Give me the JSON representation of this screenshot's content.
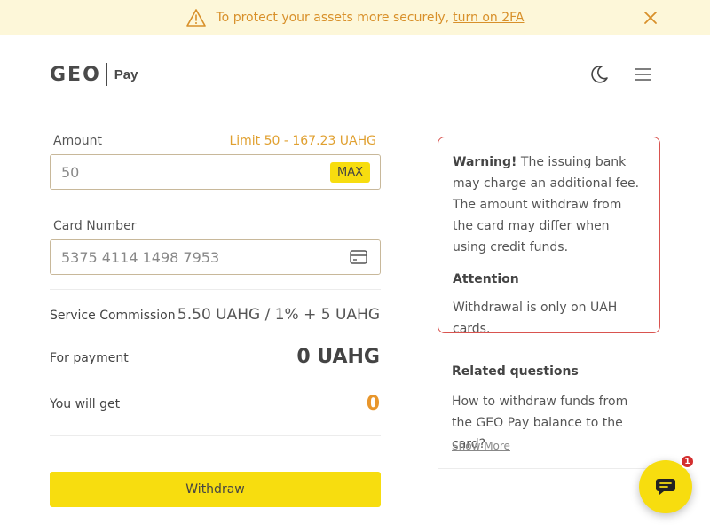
{
  "banner": {
    "text": "To protect your assets more securely,",
    "link": "turn on 2FA",
    "icon": "warning-icon",
    "close_icon": "close-icon"
  },
  "header": {
    "logo_mark": "GEO",
    "logo_product": "Pay",
    "theme_icon": "moon-icon",
    "menu_icon": "hamburger-menu-icon"
  },
  "form": {
    "amount_label": "Amount",
    "limit_text": "Limit 50 - 167.23 UAHG",
    "amount_value": "50",
    "max_label": "MAX",
    "card_label": "Card Number",
    "card_value": "5375 4114 1498 7953",
    "card_icon": "credit-card-icon"
  },
  "summary": {
    "commission_label": "Service Commission",
    "commission_value": "5.50 UAHG / 1% + 5 UAHG",
    "payment_label": "For payment",
    "payment_value": "0 UAHG",
    "get_label": "You will get",
    "get_value": "0"
  },
  "withdraw_label": "Withdraw",
  "warning": {
    "title": "Warning!",
    "text": "The issuing bank may charge an additional fee. The amount withdraw from the card may differ when using credit funds.",
    "attention_title": "Attention",
    "attention_text": "Withdrawal is only on UAH cards."
  },
  "related": {
    "title": "Related questions",
    "question": "How to withdraw funds from the GEO Pay balance to the card?",
    "show_more": "Show More"
  },
  "chat": {
    "icon": "chat-icon",
    "badge_count": "1"
  },
  "colors": {
    "accent": "#f7dd0f",
    "banner_bg": "#fdf7d9",
    "banner_text": "#d8902a",
    "warning_border": "#d9534f",
    "orange_value": "#e8962c"
  }
}
